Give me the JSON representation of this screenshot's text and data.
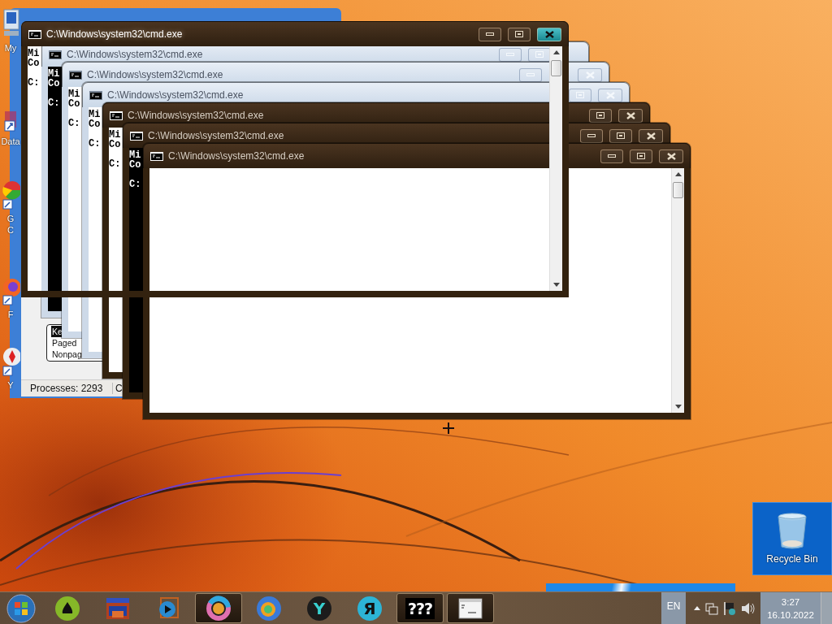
{
  "desktop_icons": [
    {
      "kind": "computer",
      "lines": [
        "My"
      ]
    },
    {
      "kind": "document",
      "lines": [
        "Data"
      ]
    },
    {
      "kind": "browser",
      "lines": [
        "G",
        "C"
      ]
    },
    {
      "kind": "fox",
      "lines": [
        "F"
      ]
    },
    {
      "kind": "yabrowser",
      "lines": [
        "Y"
      ]
    }
  ],
  "task_manager": {
    "group_items": [
      {
        "label": "Ke",
        "selected": true
      },
      {
        "label": "Paged",
        "selected": false
      },
      {
        "label": "Nonpag",
        "selected": false
      }
    ],
    "status_bar": [
      "Processes: 2293",
      "C"
    ]
  },
  "windows": [
    {
      "title": "C:\\Windows\\system32\\cmd.exe",
      "active": true,
      "faded": false,
      "inverted": false,
      "lines": [
        "Mi",
        "Co"
      ],
      "prompt": "C:"
    },
    {
      "title": "C:\\Windows\\system32\\cmd.exe",
      "active": false,
      "faded": true,
      "inverted": true,
      "lines": [
        "Mi",
        "Co"
      ],
      "prompt": "C:"
    },
    {
      "title": "C:\\Windows\\system32\\cmd.exe",
      "active": false,
      "faded": true,
      "inverted": false,
      "lines": [
        "Mi",
        "Co"
      ],
      "prompt": "C:"
    },
    {
      "title": "C:\\Windows\\system32\\cmd.exe",
      "active": false,
      "faded": true,
      "inverted": false,
      "lines": [
        "Mi",
        "Co"
      ],
      "prompt": "C:"
    },
    {
      "title": "C:\\Windows\\system32\\cmd.exe",
      "active": false,
      "faded": false,
      "inverted": false,
      "lines": [
        "Mi",
        "Co"
      ],
      "prompt": "C:"
    },
    {
      "title": "C:\\Windows\\system32\\cmd.exe",
      "active": false,
      "faded": false,
      "inverted": true,
      "lines": [
        "Mi",
        "Co"
      ],
      "prompt": "C:"
    },
    {
      "title": "C:\\Windows\\system32\\cmd.exe",
      "active": false,
      "faded": false
    }
  ],
  "recycle_bin": {
    "label": "Recycle Bin",
    "selected": true
  },
  "taskbar": {
    "apps": [
      {
        "kind": "drop",
        "running": false
      },
      {
        "kind": "folder",
        "running": false
      },
      {
        "kind": "player",
        "running": false
      },
      {
        "kind": "ring",
        "running": true
      },
      {
        "kind": "fox",
        "running": false
      },
      {
        "kind": "letter",
        "label": "Y",
        "color": "#1c1c1c",
        "running": false
      },
      {
        "kind": "letter",
        "label": "Я",
        "color": "#2cb4d6",
        "running": false
      },
      {
        "kind": "text",
        "label": "???",
        "running": true
      },
      {
        "kind": "console",
        "running": true
      }
    ],
    "language": "EN",
    "time": "3:27",
    "date": "16.10.2022"
  }
}
